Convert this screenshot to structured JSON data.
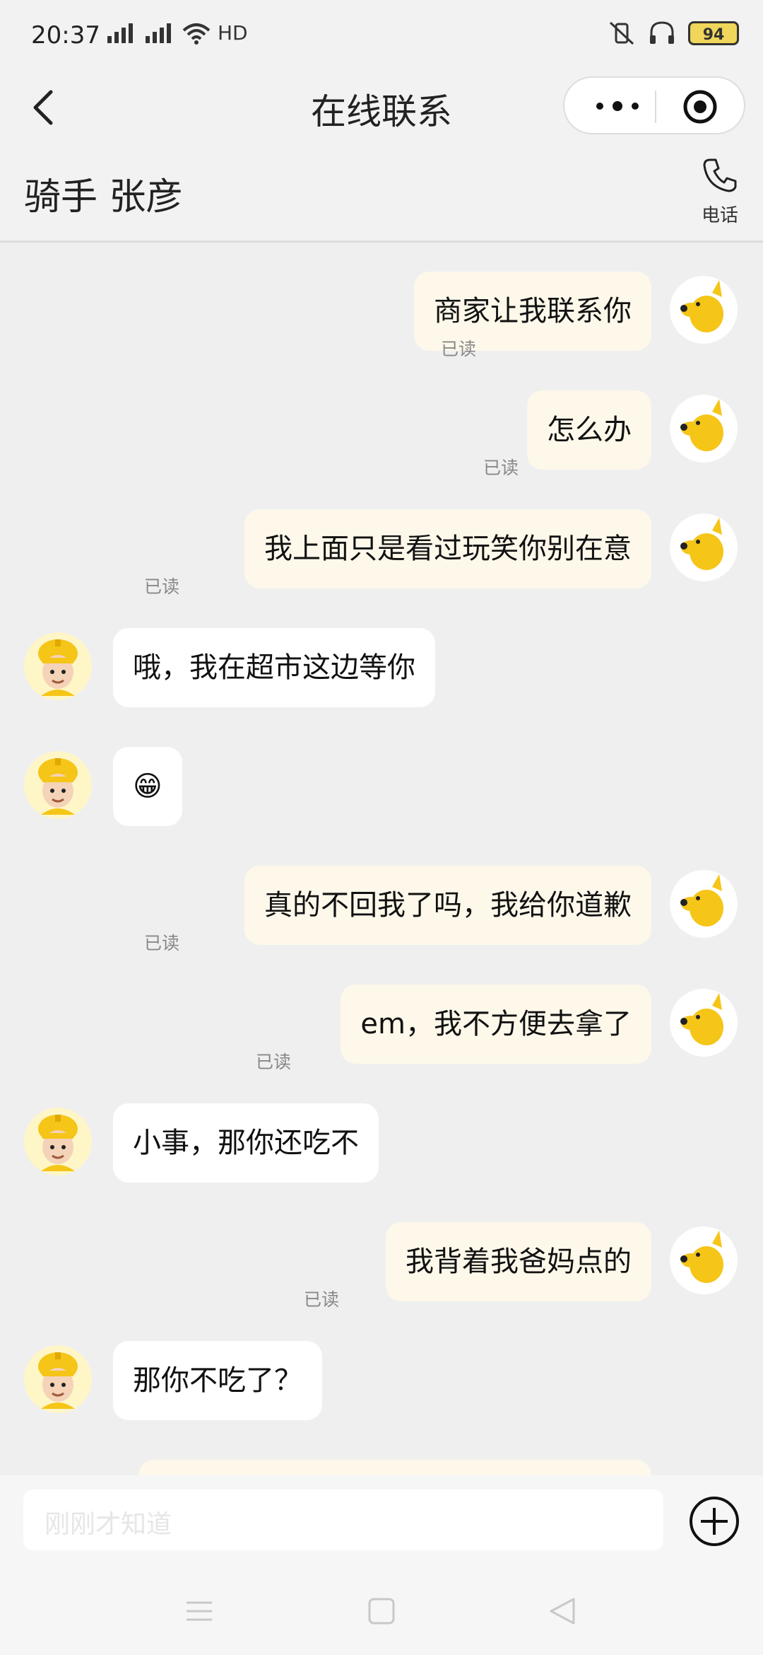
{
  "status_bar": {
    "time": "20:37",
    "network": "HD",
    "battery": "94"
  },
  "nav": {
    "title": "在线联系"
  },
  "rider": {
    "name": "骑手 张彦",
    "phone_label": "电话"
  },
  "messages": [
    {
      "side": "out",
      "text": "商家让我联系你",
      "read": "已读"
    },
    {
      "side": "out",
      "text": "怎么办",
      "read": "已读"
    },
    {
      "side": "out",
      "text": "我上面只是看过玩笑你别在意",
      "read": "已读"
    },
    {
      "side": "in",
      "text": "哦，我在超市这边等你"
    },
    {
      "side": "in",
      "text": "😁"
    },
    {
      "side": "out",
      "text": "真的不回我了吗，我给你道歉",
      "read": "已读"
    },
    {
      "side": "out",
      "text": "em，我不方便去拿了",
      "read": "已读"
    },
    {
      "side": "in",
      "text": "小事，那你还吃不"
    },
    {
      "side": "out",
      "text": "我背着我爸妈点的",
      "read": "已读"
    },
    {
      "side": "in",
      "text": "那你不吃了？"
    }
  ],
  "input": {
    "draft": "刚刚才知道"
  },
  "colors": {
    "outgoing_bubble": "#fdf8ea",
    "incoming_bubble": "#ffffff",
    "background": "#efefef"
  }
}
